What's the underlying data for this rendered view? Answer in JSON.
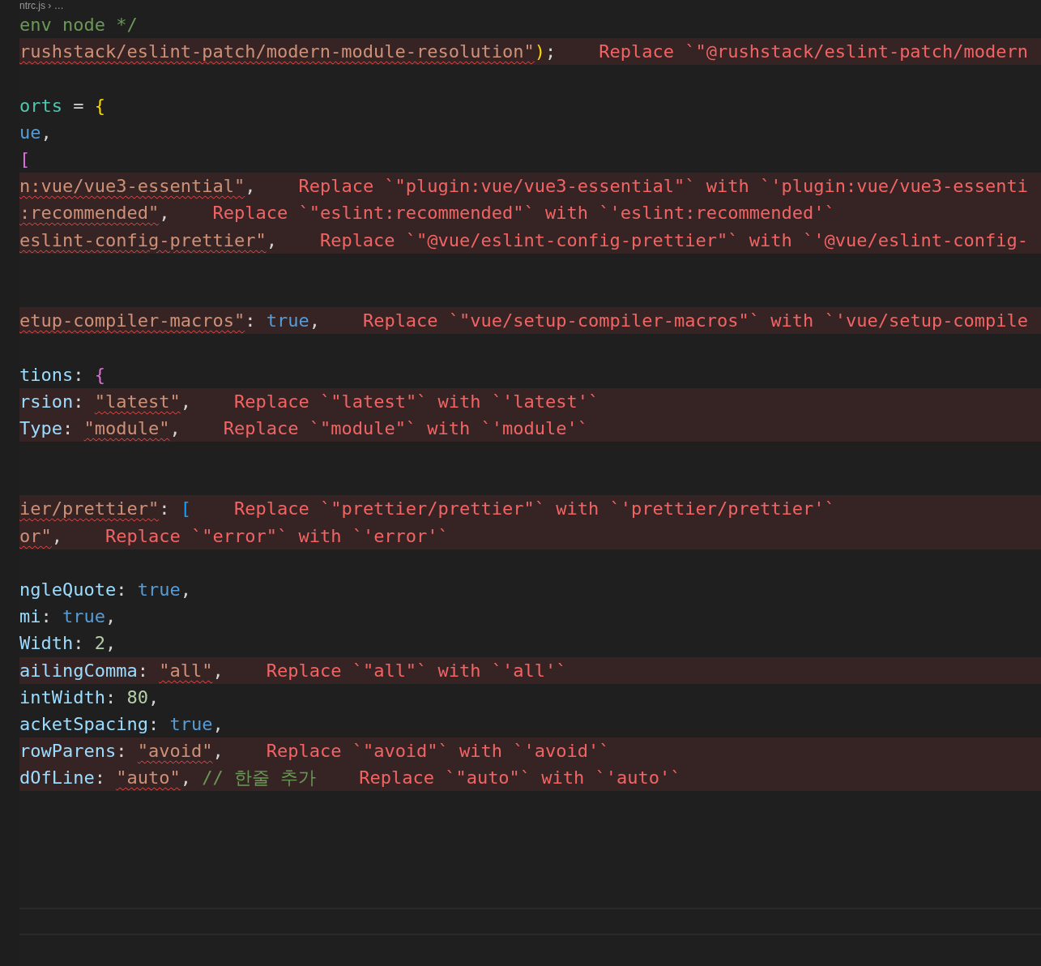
{
  "breadcrumb": "ntrc.js › …",
  "lines": [
    {
      "kind": "code",
      "code": [
        {
          "t": "env node */",
          "kind": "comment"
        }
      ]
    },
    {
      "kind": "code",
      "code": [
        {
          "t": "rushstack/eslint-patch/modern-module-resolution\"",
          "kind": "string",
          "squiggle": true
        },
        {
          "t": ")",
          "kind": "bracket_gold"
        },
        {
          "t": ";",
          "kind": "plain"
        }
      ],
      "error": "Replace `\"@rushstack/eslint-patch/modern"
    },
    {
      "kind": "blank"
    },
    {
      "kind": "code",
      "code": [
        {
          "t": "orts",
          "kind": "type"
        },
        {
          "t": " = ",
          "kind": "plain"
        },
        {
          "t": "{",
          "kind": "bracket_gold"
        }
      ]
    },
    {
      "kind": "code",
      "code": [
        {
          "t": "ue",
          "kind": "keyword"
        },
        {
          "t": ",",
          "kind": "plain"
        }
      ]
    },
    {
      "kind": "code",
      "code": [
        {
          "t": "[",
          "kind": "bracket_pink"
        }
      ]
    },
    {
      "kind": "code",
      "code": [
        {
          "t": "n:vue/vue3-essential\"",
          "kind": "string",
          "squiggle": true
        },
        {
          "t": ",",
          "kind": "plain"
        }
      ],
      "error": "Replace `\"plugin:vue/vue3-essential\"` with `'plugin:vue/vue3-essenti"
    },
    {
      "kind": "code",
      "code": [
        {
          "t": ":recommended\"",
          "kind": "string",
          "squiggle": true
        },
        {
          "t": ",",
          "kind": "plain"
        }
      ],
      "error": "Replace `\"eslint:recommended\"` with `'eslint:recommended'`"
    },
    {
      "kind": "code",
      "code": [
        {
          "t": "eslint-config-prettier\"",
          "kind": "string",
          "squiggle": true
        },
        {
          "t": ",",
          "kind": "plain"
        }
      ],
      "error": "Replace `\"@vue/eslint-config-prettier\"` with `'@vue/eslint-config-"
    },
    {
      "kind": "blank"
    },
    {
      "kind": "blank"
    },
    {
      "kind": "code",
      "code": [
        {
          "t": "etup-compiler-macros\"",
          "kind": "string",
          "squiggle": true
        },
        {
          "t": ": ",
          "kind": "plain"
        },
        {
          "t": "true",
          "kind": "keyword"
        },
        {
          "t": ",",
          "kind": "plain"
        }
      ],
      "error": "Replace `\"vue/setup-compiler-macros\"` with `'vue/setup-compile"
    },
    {
      "kind": "blank"
    },
    {
      "kind": "code",
      "code": [
        {
          "t": "tions",
          "kind": "key"
        },
        {
          "t": ": ",
          "kind": "plain"
        },
        {
          "t": "{",
          "kind": "bracket_pink"
        }
      ]
    },
    {
      "kind": "code",
      "code": [
        {
          "t": "rsion",
          "kind": "key"
        },
        {
          "t": ": ",
          "kind": "plain"
        },
        {
          "t": "\"latest\"",
          "kind": "string",
          "squiggle": true
        },
        {
          "t": ",",
          "kind": "plain"
        }
      ],
      "error": "Replace `\"latest\"` with `'latest'`"
    },
    {
      "kind": "code",
      "code": [
        {
          "t": "Type",
          "kind": "key"
        },
        {
          "t": ": ",
          "kind": "plain"
        },
        {
          "t": "\"module\"",
          "kind": "string",
          "squiggle": true
        },
        {
          "t": ",",
          "kind": "plain"
        }
      ],
      "error": "Replace `\"module\"` with `'module'`"
    },
    {
      "kind": "blank"
    },
    {
      "kind": "blank"
    },
    {
      "kind": "code",
      "code": [
        {
          "t": "ier/prettier\"",
          "kind": "string",
          "squiggle": true
        },
        {
          "t": ": ",
          "kind": "plain"
        },
        {
          "t": "[",
          "kind": "bracket_blue"
        }
      ],
      "error": "Replace `\"prettier/prettier\"` with `'prettier/prettier'`"
    },
    {
      "kind": "code",
      "code": [
        {
          "t": "or\"",
          "kind": "string",
          "squiggle": true
        },
        {
          "t": ",",
          "kind": "plain"
        }
      ],
      "error": "Replace `\"error\"` with `'error'`"
    },
    {
      "kind": "blank"
    },
    {
      "kind": "code",
      "code": [
        {
          "t": "ngleQuote",
          "kind": "key"
        },
        {
          "t": ": ",
          "kind": "plain"
        },
        {
          "t": "true",
          "kind": "keyword"
        },
        {
          "t": ",",
          "kind": "plain"
        }
      ]
    },
    {
      "kind": "code",
      "code": [
        {
          "t": "mi",
          "kind": "key"
        },
        {
          "t": ": ",
          "kind": "plain"
        },
        {
          "t": "true",
          "kind": "keyword"
        },
        {
          "t": ",",
          "kind": "plain"
        }
      ]
    },
    {
      "kind": "code",
      "code": [
        {
          "t": "Width",
          "kind": "key"
        },
        {
          "t": ": ",
          "kind": "plain"
        },
        {
          "t": "2",
          "kind": "number"
        },
        {
          "t": ",",
          "kind": "plain"
        }
      ]
    },
    {
      "kind": "code",
      "code": [
        {
          "t": "ailingComma",
          "kind": "key"
        },
        {
          "t": ": ",
          "kind": "plain"
        },
        {
          "t": "\"all\"",
          "kind": "string",
          "squiggle": true
        },
        {
          "t": ",",
          "kind": "plain"
        }
      ],
      "error": "Replace `\"all\"` with `'all'`"
    },
    {
      "kind": "code",
      "code": [
        {
          "t": "intWidth",
          "kind": "key"
        },
        {
          "t": ": ",
          "kind": "plain"
        },
        {
          "t": "80",
          "kind": "number"
        },
        {
          "t": ",",
          "kind": "plain"
        }
      ]
    },
    {
      "kind": "code",
      "code": [
        {
          "t": "acketSpacing",
          "kind": "key"
        },
        {
          "t": ": ",
          "kind": "plain"
        },
        {
          "t": "true",
          "kind": "keyword"
        },
        {
          "t": ",",
          "kind": "plain"
        }
      ]
    },
    {
      "kind": "code",
      "code": [
        {
          "t": "rowParens",
          "kind": "key"
        },
        {
          "t": ": ",
          "kind": "plain"
        },
        {
          "t": "\"avoid\"",
          "kind": "string",
          "squiggle": true
        },
        {
          "t": ",",
          "kind": "plain"
        }
      ],
      "error": "Replace `\"avoid\"` with `'avoid'`"
    },
    {
      "kind": "code",
      "code": [
        {
          "t": "dOfLine",
          "kind": "key"
        },
        {
          "t": ": ",
          "kind": "plain"
        },
        {
          "t": "\"auto\"",
          "kind": "string",
          "squiggle": true
        },
        {
          "t": ", ",
          "kind": "plain"
        },
        {
          "t": "// 한줄 추가",
          "kind": "comment"
        }
      ],
      "error": "Replace `\"auto\"` with `'auto'`"
    }
  ]
}
